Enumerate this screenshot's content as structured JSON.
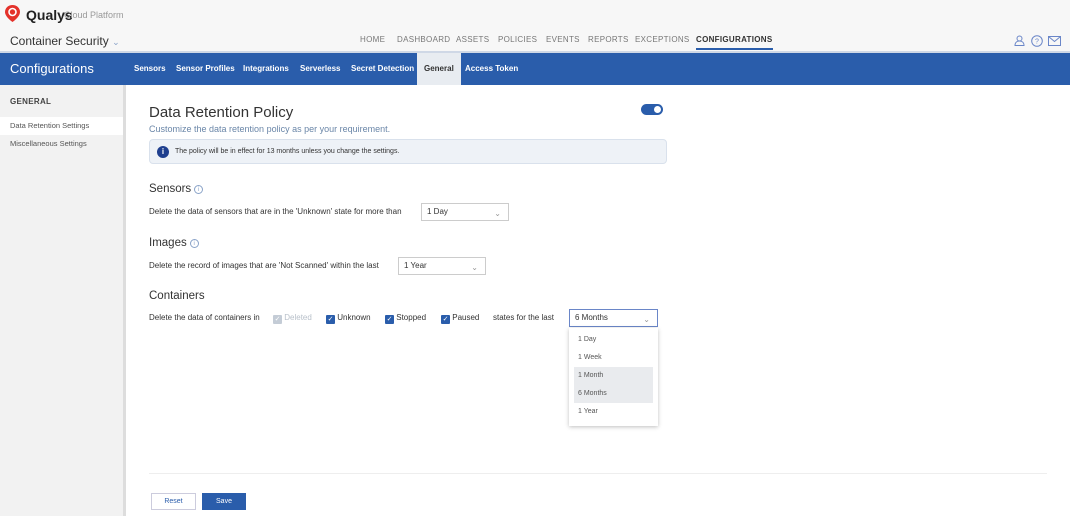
{
  "header": {
    "logo": "Qualys",
    "logo_sub": "Cloud Platform",
    "product": "Container Security",
    "nav": [
      "HOME",
      "DASHBOARD",
      "ASSETS",
      "POLICIES",
      "EVENTS",
      "REPORTS",
      "EXCEPTIONS",
      "CONFIGURATIONS"
    ],
    "active_nav": "CONFIGURATIONS"
  },
  "subnav": {
    "title": "Configurations",
    "tabs": [
      "Sensors",
      "Sensor Profiles",
      "Integrations",
      "Serverless",
      "Secret Detection",
      "General",
      "Access Token"
    ],
    "active": "General"
  },
  "sidebar": {
    "heading": "GENERAL",
    "items": [
      "Data Retention Settings",
      "Miscellaneous Settings"
    ],
    "active": "Data Retention Settings"
  },
  "main": {
    "title": "Data Retention Policy",
    "subtitle": "Customize the data retention policy as per your requirement.",
    "enabled": true,
    "info": "The policy will be in effect for 13 months unless you change the settings.",
    "sensors": {
      "heading": "Sensors",
      "label": "Delete the data of sensors that are in the 'Unknown' state for more than",
      "value": "1 Day"
    },
    "images": {
      "heading": "Images",
      "label": "Delete the record of images that are 'Not Scanned' within the last",
      "value": "1 Year"
    },
    "containers": {
      "heading": "Containers",
      "label": "Delete the data of containers in",
      "states": [
        {
          "label": "Deleted",
          "checked": true,
          "disabled": true
        },
        {
          "label": "Unknown",
          "checked": true
        },
        {
          "label": "Stopped",
          "checked": true
        },
        {
          "label": "Paused",
          "checked": true
        }
      ],
      "suffix": "states for the last",
      "value": "6 Months",
      "options": [
        "1 Day",
        "1 Week",
        "1 Month",
        "6 Months",
        "1 Year"
      ]
    },
    "reset": "Reset",
    "save": "Save"
  },
  "colors": {
    "brand": "#2a5dab",
    "logo": "#e4322b"
  }
}
